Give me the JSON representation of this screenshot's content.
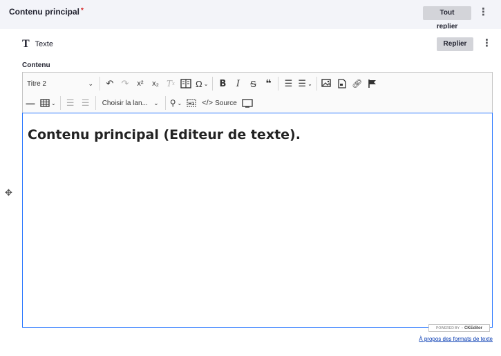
{
  "header": {
    "title": "Contenu principal",
    "required_mark": "*",
    "collapse_all_label": "Tout replier",
    "menu_glyph": "⋮"
  },
  "paragraph": {
    "type_icon": "T",
    "type_label": "Texte",
    "collapse_label": "Replier",
    "menu_glyph": "⋮"
  },
  "field": {
    "label": "Contenu"
  },
  "toolbar": {
    "heading_select": "Titre 2",
    "language_select": "Choisir la lan...",
    "source_label": "Source",
    "icons_row1": [
      "undo-icon",
      "redo-icon",
      "superscript-icon",
      "subscript-icon",
      "remove-format-icon",
      "book-icon",
      "special-char-icon",
      "bold-icon",
      "italic-icon",
      "strikethrough-icon",
      "blockquote-icon",
      "bulleted-list-icon",
      "numbered-list-icon",
      "image-icon",
      "media-icon",
      "link-icon",
      "flag-icon"
    ],
    "icons_row2": [
      "horizontal-line-icon",
      "table-icon",
      "outdent-icon",
      "indent-icon",
      "find-replace-icon",
      "heading-h1-icon",
      "source-icon",
      "fullscreen-icon"
    ]
  },
  "editor": {
    "content_heading": "Contenu principal (Editeur de texte)."
  },
  "badge": {
    "powered_by": "POWERED BY",
    "brand": "CKEditor"
  },
  "footer": {
    "formats_link": "À propos des formats de texte"
  },
  "colors": {
    "header_bg": "#f3f4f9",
    "button_bg": "#d3d4d9",
    "focus_border": "#2977ff",
    "link": "#0036b1",
    "required": "#d72222"
  }
}
